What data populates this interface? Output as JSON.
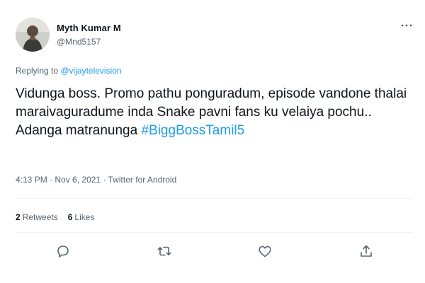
{
  "author": {
    "display_name": "Myth Kumar M",
    "handle": "@Mnd5157"
  },
  "reply": {
    "prefix": "Replying to ",
    "mention": "@vijaytelevision"
  },
  "tweet": {
    "text": "Vidunga boss. Promo pathu ponguradum, episode vandone thalai maraivaguradume inda Snake pavni fans ku velaiya pochu.. Adanga matranunga ",
    "hashtag": "#BiggBossTamil5"
  },
  "meta": {
    "time": "4:13 PM",
    "sep1": " · ",
    "date": "Nov 6, 2021",
    "sep2": " · ",
    "source": "Twitter for Android"
  },
  "stats": {
    "retweets_count": "2",
    "retweets_label": "Retweets",
    "likes_count": "6",
    "likes_label": "Likes"
  },
  "icons": {
    "more": "more-horizontal-icon",
    "reply": "reply-icon",
    "retweet": "retweet-icon",
    "like": "heart-icon",
    "share": "share-icon"
  },
  "colors": {
    "link": "#1d9bf0",
    "secondary_text": "#536471",
    "primary_text": "#0f1419"
  }
}
